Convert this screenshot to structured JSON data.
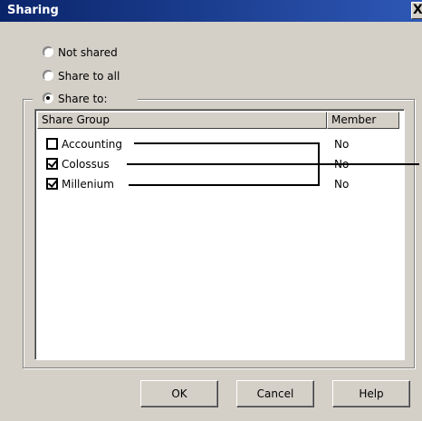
{
  "window": {
    "title": "Sharing",
    "close_glyph": "X"
  },
  "sharing_options": [
    {
      "label": "Not shared",
      "selected": false
    },
    {
      "label": "Share to all",
      "selected": false
    },
    {
      "label": "Share to:",
      "selected": true
    }
  ],
  "list": {
    "columns": [
      "Share Group",
      "Member"
    ],
    "rows": [
      {
        "group": "Accounting",
        "checked": false,
        "member": "No"
      },
      {
        "group": "Colossus",
        "checked": true,
        "member": "No"
      },
      {
        "group": "Millenium",
        "checked": true,
        "member": "No"
      }
    ]
  },
  "buttons": {
    "ok": "OK",
    "cancel": "Cancel",
    "help": "Help"
  },
  "colors": {
    "dialog_face": "#d4d0c8",
    "titlebar_start": "#0a246a",
    "titlebar_end": "#2e58b6"
  }
}
